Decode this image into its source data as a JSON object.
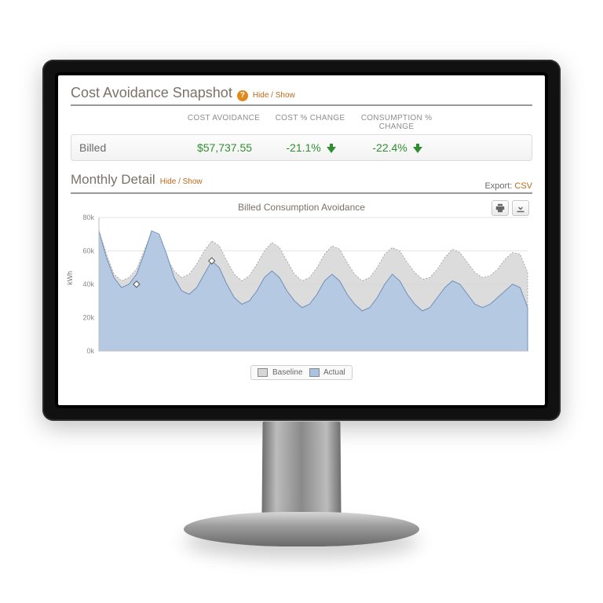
{
  "snapshot": {
    "title": "Cost Avoidance Snapshot",
    "toggle": "Hide / Show",
    "headers": {
      "cost_avoidance": "COST AVOIDANCE",
      "cost_pct": "COST % CHANGE",
      "cons_pct": "CONSUMPTION % CHANGE"
    },
    "row": {
      "label": "Billed",
      "cost_avoidance": "$57,737.55",
      "cost_pct": "-21.1%",
      "cons_pct": "-22.4%"
    }
  },
  "detail": {
    "title": "Monthly Detail",
    "toggle": "Hide / Show",
    "export_label": "Export:",
    "export_csv": "CSV"
  },
  "chart_labels": {
    "title": "Billed Consumption Avoidance",
    "ylabel": "kWh",
    "legend_baseline": "Baseline",
    "legend_actual": "Actual"
  },
  "chart_data": {
    "type": "area",
    "title": "Billed Consumption Avoidance",
    "xlabel": "",
    "ylabel": "kWh",
    "ylim": [
      0,
      80000
    ],
    "yticks": [
      "0k",
      "20k",
      "40k",
      "60k",
      "80k"
    ],
    "x": [
      1,
      2,
      3,
      4,
      5,
      6,
      7,
      8,
      9,
      10,
      11,
      12,
      13,
      14,
      15,
      16,
      17,
      18,
      19,
      20,
      21,
      22,
      23,
      24,
      25,
      26,
      27,
      28,
      29,
      30,
      31,
      32,
      33,
      34,
      35,
      36,
      37,
      38,
      39,
      40,
      41,
      42,
      43,
      44,
      45,
      46,
      47,
      48,
      49,
      50,
      51,
      52,
      53,
      54,
      55,
      56,
      57,
      58
    ],
    "series": [
      {
        "name": "Baseline",
        "color": "#d6d6d6",
        "values": [
          72000,
          58000,
          46000,
          42000,
          44000,
          49000,
          60000,
          71000,
          68000,
          56000,
          48000,
          44000,
          46000,
          52000,
          60000,
          66000,
          63000,
          54000,
          46000,
          42000,
          45000,
          52000,
          60000,
          65000,
          62000,
          54000,
          46000,
          42000,
          44000,
          50000,
          58000,
          63000,
          61000,
          53000,
          46000,
          42000,
          44000,
          50000,
          58000,
          62000,
          60000,
          53000,
          47000,
          43000,
          44000,
          49000,
          56000,
          61000,
          59000,
          53000,
          47000,
          44000,
          45000,
          49000,
          55000,
          59000,
          58000,
          47000
        ]
      },
      {
        "name": "Actual",
        "color": "#a9c3e4",
        "values": [
          72000,
          56000,
          44000,
          38000,
          40000,
          46000,
          58000,
          72000,
          70000,
          58000,
          44000,
          36000,
          34000,
          38000,
          46000,
          54000,
          50000,
          40000,
          32000,
          28000,
          30000,
          36000,
          44000,
          48000,
          44000,
          36000,
          30000,
          26000,
          28000,
          34000,
          42000,
          46000,
          42000,
          34000,
          28000,
          24000,
          26000,
          32000,
          40000,
          46000,
          42000,
          34000,
          28000,
          24000,
          26000,
          32000,
          38000,
          42000,
          40000,
          34000,
          28000,
          26000,
          28000,
          32000,
          36000,
          40000,
          38000,
          26000
        ]
      }
    ],
    "legend_position": "bottom",
    "grid": true
  }
}
